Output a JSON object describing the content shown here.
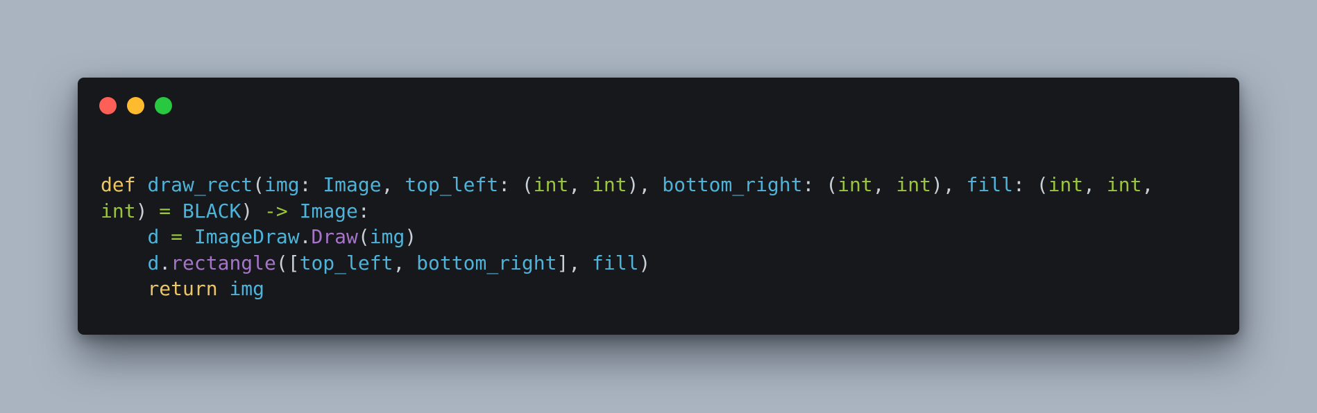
{
  "colors": {
    "page_background": "#a9b4c0",
    "window_background": "#17181b",
    "close": "#fe5f57",
    "minimize": "#febb2e",
    "zoom": "#28c840",
    "keyword": "#ecc565",
    "identifier": "#4fb2d9",
    "builtin_type": "#9bc53d",
    "method": "#a675c9",
    "punctuation": "#c9cfd6"
  },
  "window": {
    "controls": [
      {
        "name": "close",
        "icon": "close-dot-icon",
        "color": "#fe5f57"
      },
      {
        "name": "minimize",
        "icon": "minimize-dot-icon",
        "color": "#febb2e"
      },
      {
        "name": "zoom",
        "icon": "zoom-dot-icon",
        "color": "#28c840"
      }
    ]
  },
  "code": {
    "language": "python",
    "lines": [
      [
        {
          "t": "def",
          "c": "kw"
        },
        {
          "t": " ",
          "c": "punc"
        },
        {
          "t": "draw_rect",
          "c": "fn"
        },
        {
          "t": "(",
          "c": "punc"
        },
        {
          "t": "img",
          "c": "var"
        },
        {
          "t": ": ",
          "c": "punc"
        },
        {
          "t": "Image",
          "c": "var"
        },
        {
          "t": ", ",
          "c": "punc"
        },
        {
          "t": "top_left",
          "c": "var"
        },
        {
          "t": ": (",
          "c": "punc"
        },
        {
          "t": "int",
          "c": "type"
        },
        {
          "t": ", ",
          "c": "punc"
        },
        {
          "t": "int",
          "c": "type"
        },
        {
          "t": "), ",
          "c": "punc"
        },
        {
          "t": "bottom_right",
          "c": "var"
        },
        {
          "t": ": (",
          "c": "punc"
        },
        {
          "t": "int",
          "c": "type"
        },
        {
          "t": ", ",
          "c": "punc"
        },
        {
          "t": "int",
          "c": "type"
        },
        {
          "t": "), ",
          "c": "punc"
        },
        {
          "t": "fill",
          "c": "var"
        },
        {
          "t": ": (",
          "c": "punc"
        },
        {
          "t": "int",
          "c": "type"
        },
        {
          "t": ", ",
          "c": "punc"
        },
        {
          "t": "int",
          "c": "type"
        },
        {
          "t": ",",
          "c": "punc"
        }
      ],
      [
        {
          "t": "int",
          "c": "type"
        },
        {
          "t": ") ",
          "c": "punc"
        },
        {
          "t": "=",
          "c": "op"
        },
        {
          "t": " ",
          "c": "punc"
        },
        {
          "t": "BLACK",
          "c": "var"
        },
        {
          "t": ") ",
          "c": "punc"
        },
        {
          "t": "->",
          "c": "op"
        },
        {
          "t": " ",
          "c": "punc"
        },
        {
          "t": "Image",
          "c": "var"
        },
        {
          "t": ":",
          "c": "punc"
        }
      ],
      [
        {
          "t": "    ",
          "c": "punc"
        },
        {
          "t": "d",
          "c": "var"
        },
        {
          "t": " ",
          "c": "punc"
        },
        {
          "t": "=",
          "c": "op"
        },
        {
          "t": " ",
          "c": "punc"
        },
        {
          "t": "ImageDraw",
          "c": "var"
        },
        {
          "t": ".",
          "c": "punc"
        },
        {
          "t": "Draw",
          "c": "method"
        },
        {
          "t": "(",
          "c": "punc"
        },
        {
          "t": "img",
          "c": "var"
        },
        {
          "t": ")",
          "c": "punc"
        }
      ],
      [
        {
          "t": "    ",
          "c": "punc"
        },
        {
          "t": "d",
          "c": "var"
        },
        {
          "t": ".",
          "c": "punc"
        },
        {
          "t": "rectangle",
          "c": "method"
        },
        {
          "t": "([",
          "c": "punc"
        },
        {
          "t": "top_left",
          "c": "var"
        },
        {
          "t": ", ",
          "c": "punc"
        },
        {
          "t": "bottom_right",
          "c": "var"
        },
        {
          "t": "], ",
          "c": "punc"
        },
        {
          "t": "fill",
          "c": "var"
        },
        {
          "t": ")",
          "c": "punc"
        }
      ],
      [
        {
          "t": "    ",
          "c": "punc"
        },
        {
          "t": "return",
          "c": "kw"
        },
        {
          "t": " ",
          "c": "punc"
        },
        {
          "t": "img",
          "c": "var"
        }
      ]
    ]
  }
}
